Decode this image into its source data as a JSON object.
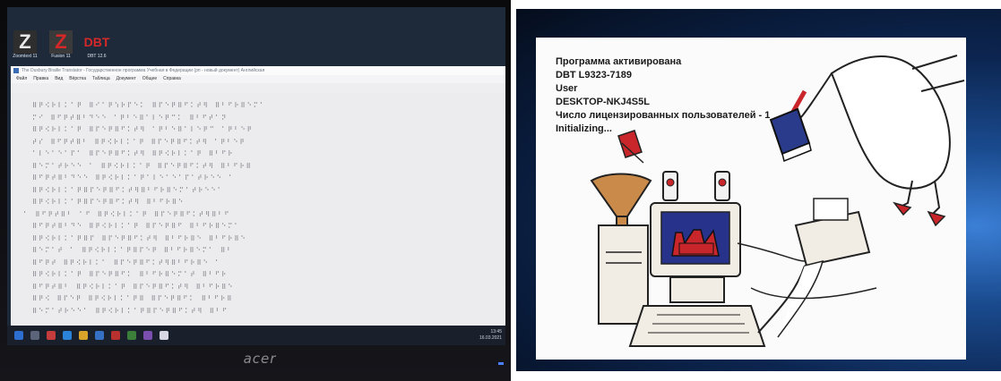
{
  "left_photo": {
    "desktop_icons": [
      {
        "glyph": "Z",
        "label": "Zoomtext 11"
      },
      {
        "glyph": "Z",
        "label": "Fusion 11"
      },
      {
        "glyph": "DBT",
        "label": "DBT 12.6"
      }
    ],
    "window_title": "The Duxbury Braille Translator - Государственное программа Учебная в Федерации (рп - новый документ) Английская",
    "menu": [
      "Файл",
      "Правка",
      "Вид",
      "Вёрстка",
      "Таблица",
      "Документ",
      "Общее",
      "Справка"
    ],
    "braille_lines": [
      "⠿⠟⠪⠗⠇⠅⠁⠟ ⠿⠊⠁⠟⠱⠗⠏⠑⠅ ⠿⠏⠑⠟⠿⠋⠅⠞⠻ ⠿⠃⠋⠗⠿⠑⠍⠁",
      "⠍⠊ ⠿⠋⠟⠞⠿⠃⠙⠑⠑ ⠁⠟⠃⠑⠿⠁⠇⠑⠟⠉⠅ ⠿⠃⠋⠞⠁⠝",
      "⠿⠟⠪⠗⠇⠅⠁⠟ ⠿⠏⠑⠟⠿⠋⠅⠞⠻ ⠁⠟⠃⠑⠿⠁⠇⠑⠟⠉ ⠁⠟⠃⠑⠟",
      "⠞⠎ ⠿⠋⠟⠞⠿⠃ ⠿⠟⠪⠗⠇⠅⠁⠟ ⠿⠏⠑⠟⠿⠋⠅⠞⠻ ⠁⠟⠃⠑⠟",
      "⠁⠇⠑⠁⠑⠁⠏⠁ ⠿⠏⠑⠟⠿⠋⠅⠞⠻ ⠿⠟⠪⠗⠇⠅⠁⠟ ⠿⠃⠋⠗",
      "⠿⠑⠍⠁⠞⠗⠑⠑ ⠁ ⠿⠟⠪⠗⠇⠅⠁⠟ ⠿⠏⠑⠟⠿⠋⠅⠞⠻ ⠿⠃⠋⠗⠿",
      "⠿⠋⠟⠞⠿⠃⠙⠑⠑ ⠿⠟⠪⠗⠇⠅⠁⠟⠁⠇⠑⠁⠑⠁⠏⠁⠞⠗⠑⠑ ⠁",
      "⠿⠟⠪⠗⠇⠅⠁⠟⠿⠏⠑⠟⠿⠋⠅⠞⠻⠿⠃⠋⠗⠿⠑⠍⠁⠞⠗⠑⠑⠁",
      "⠿⠟⠪⠗⠇⠅⠁⠟⠿⠏⠑⠟⠿⠋⠅⠞⠻ ⠿⠃⠋⠗⠿⠑",
      "⠁ ⠿⠋⠟⠞⠿⠃ ⠁⠋ ⠿⠟⠪⠗⠇⠅⠁⠟ ⠿⠏⠑⠟⠿⠋⠅⠞⠻⠿⠃⠋",
      "⠿⠋⠟⠞⠿⠃⠙⠑ ⠿⠟⠪⠗⠇⠅⠁⠟ ⠿⠏⠑⠟⠿⠋ ⠿⠃⠋⠗⠿⠑⠍⠁",
      "⠿⠟⠪⠗⠇⠅⠁⠟⠿⠏ ⠿⠏⠑⠟⠿⠋⠅⠞⠻ ⠿⠃⠋⠗⠿⠑ ⠿⠃⠋⠗⠿⠑",
      "⠿⠑⠍⠁⠞ ⠁ ⠿⠟⠪⠗⠇⠅⠁⠟⠿⠏⠑⠟ ⠿⠃⠋⠗⠿⠑⠍⠁ ⠿⠃",
      "⠿⠋⠟⠞ ⠿⠟⠪⠗⠇⠅⠁ ⠿⠏⠑⠟⠿⠋⠅⠞⠻⠿⠃⠋⠗⠿⠑ ⠁",
      "⠿⠟⠪⠗⠇⠅⠁⠟ ⠿⠏⠑⠟⠿⠋⠅ ⠿⠃⠋⠗⠿⠑⠍⠁⠞ ⠿⠃⠋⠗",
      "⠿⠋⠟⠞⠿⠃ ⠿⠟⠪⠗⠇⠅⠁⠟ ⠿⠏⠑⠟⠿⠋⠅⠞⠻ ⠿⠃⠋⠗⠿⠑",
      "⠿⠟⠪ ⠿⠏⠑⠟ ⠿⠟⠪⠗⠇⠅⠁⠟⠿ ⠿⠏⠑⠟⠿⠋⠅ ⠿⠃⠋⠗⠿",
      "⠿⠑⠍⠁⠞⠗⠑⠑⠁ ⠿⠟⠪⠗⠇⠅⠁⠟⠿⠏⠑⠟⠿⠋⠅⠞⠻ ⠿⠃⠋"
    ],
    "taskbar_time": "13:45",
    "taskbar_date": "16.03.2021",
    "monitor_brand": "acer",
    "colors": {
      "screen_bg": "#1e2a3a",
      "doc_bg": "#ececef",
      "braille": "#4a4a55",
      "taskbar": "#1a1f2c"
    }
  },
  "right_photo": {
    "splash_lines": [
      "Программа активирована",
      "DBT L9323-7189",
      "User",
      "DESKTOP-NKJ4S5L",
      "Число лицензированных пользователей - 1",
      "Initializing..."
    ],
    "logo_text": "DBT",
    "colors": {
      "splash_bg": "#fbfbfb",
      "accent_red": "#c8262a",
      "book_blue": "#2b3b8c",
      "desktop_blue": "#1a4b8f"
    }
  }
}
